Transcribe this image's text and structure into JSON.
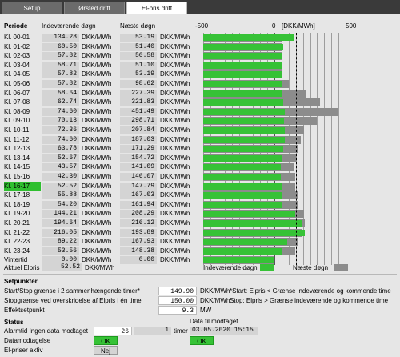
{
  "tabs": [
    {
      "label": "Setup",
      "active": false
    },
    {
      "label": "Ørsted drift",
      "active": false
    },
    {
      "label": "El-pris drift",
      "active": true
    }
  ],
  "header": {
    "col_period": "Periode",
    "col_current": "Indeværende døgn",
    "col_next": "Næste døgn",
    "scale_min": "-500",
    "scale_zero": "0",
    "scale_unit": "[DKK/MWh]",
    "scale_max": "500"
  },
  "unit": "DKK/MWh",
  "highlight_period": "Kl. 16-17",
  "chart_data": {
    "type": "bar",
    "xlim": [
      -500,
      500
    ],
    "threshold_dashed": 150,
    "categories": [
      "Kl. 00-01",
      "Kl. 01-02",
      "Kl. 02-03",
      "Kl. 03-04",
      "Kl. 04-05",
      "Kl. 05-06",
      "Kl. 06-07",
      "Kl. 07-08",
      "Kl. 08-09",
      "Kl. 09-10",
      "Kl. 10-11",
      "Kl. 11-12",
      "Kl. 12-13",
      "Kl. 13-14",
      "Kl. 14-15",
      "Kl. 15-16",
      "Kl. 16-17",
      "Kl. 17-18",
      "Kl. 18-19",
      "Kl. 19-20",
      "Kl. 20-21",
      "Kl. 21-22",
      "Kl. 22-23",
      "Kl. 23-24",
      "Vintertid"
    ],
    "series": [
      {
        "name": "Indeværende døgn",
        "color": "#36c236",
        "values": [
          134.28,
          60.5,
          57.82,
          58.71,
          57.82,
          57.82,
          58.64,
          62.74,
          74.6,
          70.13,
          72.36,
          74.6,
          63.78,
          52.67,
          43.57,
          42.3,
          52.52,
          55.88,
          54.2,
          144.21,
          194.64,
          216.05,
          89.22,
          53.56,
          0.0
        ],
        "labels": [
          "134.28",
          "60.50",
          "57.82",
          "58.71",
          "57.82",
          "57.82",
          "58.64",
          "62.74",
          "74.60",
          "70.13",
          "72.36",
          "74.60",
          "63.78",
          "52.67",
          "43.57",
          "42.30",
          "52.52",
          "55.88",
          "54.20",
          "144.21",
          "194.64",
          "216.05",
          "89.22",
          "53.56",
          "0.00"
        ]
      },
      {
        "name": "Næste døgn",
        "color": "#8c8c8c",
        "values": [
          53.19,
          51.4,
          50.58,
          51.1,
          53.19,
          98.62,
          227.39,
          321.83,
          451.49,
          298.71,
          207.84,
          187.03,
          171.29,
          154.72,
          141.09,
          146.07,
          147.79,
          167.03,
          161.94,
          208.29,
          216.12,
          193.89,
          167.93,
          148.38,
          0.0
        ],
        "labels": [
          "53.19",
          "51.40",
          "50.58",
          "51.10",
          "53.19",
          "98.62",
          "227.39",
          "321.83",
          "451.49",
          "298.71",
          "207.84",
          "187.03",
          "171.29",
          "154.72",
          "141.09",
          "146.07",
          "147.79",
          "167.03",
          "161.94",
          "208.29",
          "216.12",
          "193.89",
          "167.93",
          "148.38",
          "0.00"
        ]
      }
    ]
  },
  "current_price": {
    "label": "Aktuel Elpris",
    "value": "52.52",
    "unit": "DKK/MWh"
  },
  "legend": {
    "current": "Indeværende døgn",
    "next": "Næste døgn"
  },
  "setpoints": {
    "title": "Setpunkter",
    "items": [
      {
        "label": "Start/Stop grænse i 2 sammenhængende timer*",
        "value": "149.90",
        "unit": "DKK/MWh",
        "note": "*Start: Elpris < Grænse indeværende og kommende time"
      },
      {
        "label": "Stopgrænse ved overskridelse af Elpris i én time",
        "value": "150.00",
        "unit": "DKK/MWh",
        "note": "Stop: Elpris > Grænse indeværende og kommende time"
      },
      {
        "label": "Effektsetpunkt",
        "value": "9.3",
        "unit": "MW",
        "note": ""
      }
    ]
  },
  "status": {
    "title": "Status",
    "data_file_label": "Data fil modtaget",
    "alarm_label": "Alarmtid Ingen data modtaget",
    "alarm_value": "26",
    "alarm_box2": "1",
    "alarm_unit": "timer",
    "data_file_time": "03.05.2020 15:15",
    "data_received_label": "Datamodtagelse",
    "data_received_state": "OK",
    "data_file_state": "OK",
    "elpris_active_label": "El-priser aktiv",
    "elpris_active_state": "Nej"
  }
}
